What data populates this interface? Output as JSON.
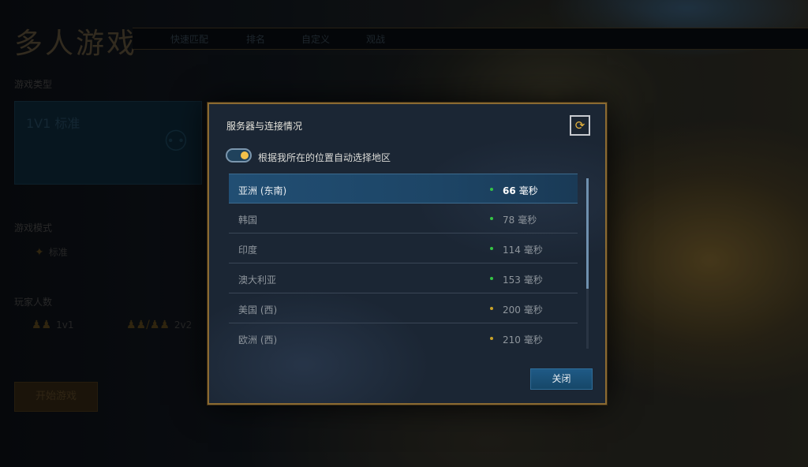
{
  "page": {
    "title": "多人游戏",
    "tabs": [
      "快速匹配",
      "排名",
      "自定义",
      "观战"
    ],
    "game_type_label": "游戏类型",
    "game_type_card": "1V1 标准",
    "game_mode_label": "游戏模式",
    "game_mode_option": "标准",
    "player_count_label": "玩家人数",
    "player_options": [
      "1v1",
      "2v2"
    ],
    "start_button": "开始游戏"
  },
  "modal": {
    "title": "服务器与连接情况",
    "auto_region_label": "根据我所在的位置自动选择地区",
    "auto_region_enabled": true,
    "servers": [
      {
        "name": "亚洲 (东南)",
        "latency": "66",
        "unit": "毫秒",
        "status": "green",
        "selected": true
      },
      {
        "name": "韩国",
        "latency": "78",
        "unit": "毫秒",
        "status": "green",
        "selected": false
      },
      {
        "name": "印度",
        "latency": "114",
        "unit": "毫秒",
        "status": "green",
        "selected": false
      },
      {
        "name": "澳大利亚",
        "latency": "153",
        "unit": "毫秒",
        "status": "green",
        "selected": false
      },
      {
        "name": "美国 (西)",
        "latency": "200",
        "unit": "毫秒",
        "status": "yellow",
        "selected": false
      },
      {
        "name": "欧洲 (西)",
        "latency": "210",
        "unit": "毫秒",
        "status": "yellow",
        "selected": false
      }
    ],
    "close_label": "关闭",
    "refresh_icon": "refresh-icon"
  },
  "colors": {
    "accent_gold": "#8a6a32",
    "status_green": "#35c445",
    "status_yellow": "#c9a227",
    "selected_row": "#214e73"
  }
}
